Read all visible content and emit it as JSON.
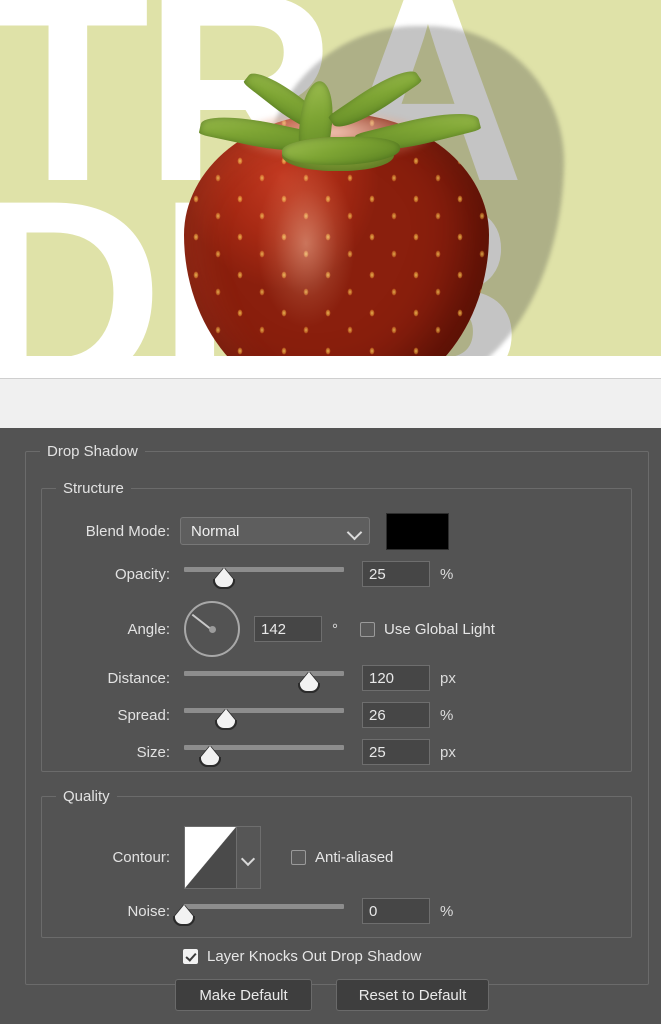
{
  "canvas": {
    "poster_line1": "TRA",
    "poster_line2": "DEB",
    "background_color": "#dfe2a8",
    "subject": "strawberry-photo"
  },
  "dialog": {
    "group_title": "Drop Shadow",
    "structure": {
      "legend": "Structure",
      "blend_mode": {
        "label": "Blend Mode:",
        "value": "Normal",
        "color_swatch": "#000000"
      },
      "opacity": {
        "label": "Opacity:",
        "value": "25",
        "unit": "%",
        "slider_percent": 25
      },
      "angle": {
        "label": "Angle:",
        "value": "142",
        "unit": "°",
        "dial_degrees": 142,
        "use_global_light": {
          "label": "Use Global Light",
          "checked": false
        }
      },
      "distance": {
        "label": "Distance:",
        "value": "120",
        "unit": "px",
        "slider_percent": 78
      },
      "spread": {
        "label": "Spread:",
        "value": "26",
        "unit": "%",
        "slider_percent": 26
      },
      "size": {
        "label": "Size:",
        "value": "25",
        "unit": "px",
        "slider_percent": 16
      }
    },
    "quality": {
      "legend": "Quality",
      "contour": {
        "label": "Contour:",
        "preset": "linear-contour"
      },
      "anti_aliased": {
        "label": "Anti-aliased",
        "checked": false
      },
      "noise": {
        "label": "Noise:",
        "value": "0",
        "unit": "%",
        "slider_percent": 0
      }
    },
    "layer_knocks_out": {
      "label": "Layer Knocks Out Drop Shadow",
      "checked": true
    },
    "buttons": {
      "make_default": "Make Default",
      "reset_to_default": "Reset to Default"
    }
  }
}
